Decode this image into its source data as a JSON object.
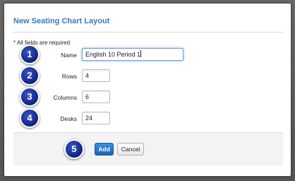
{
  "dialog": {
    "title": "New Seating Chart Layout",
    "required_note": "* All fields are required"
  },
  "form": {
    "name": {
      "label": "Name",
      "value": "English 10 Period 1"
    },
    "rows": {
      "label": "Rows",
      "value": "4"
    },
    "columns": {
      "label": "Columns",
      "value": "6"
    },
    "desks": {
      "label": "Desks",
      "value": "24"
    }
  },
  "buttons": {
    "add": "Add",
    "cancel": "Cancel"
  },
  "steps": [
    "1",
    "2",
    "3",
    "4",
    "5"
  ],
  "colors": {
    "title": "#3a7ab8",
    "step_badge": "#1a2f9a",
    "primary_button": "#1a63b8"
  }
}
